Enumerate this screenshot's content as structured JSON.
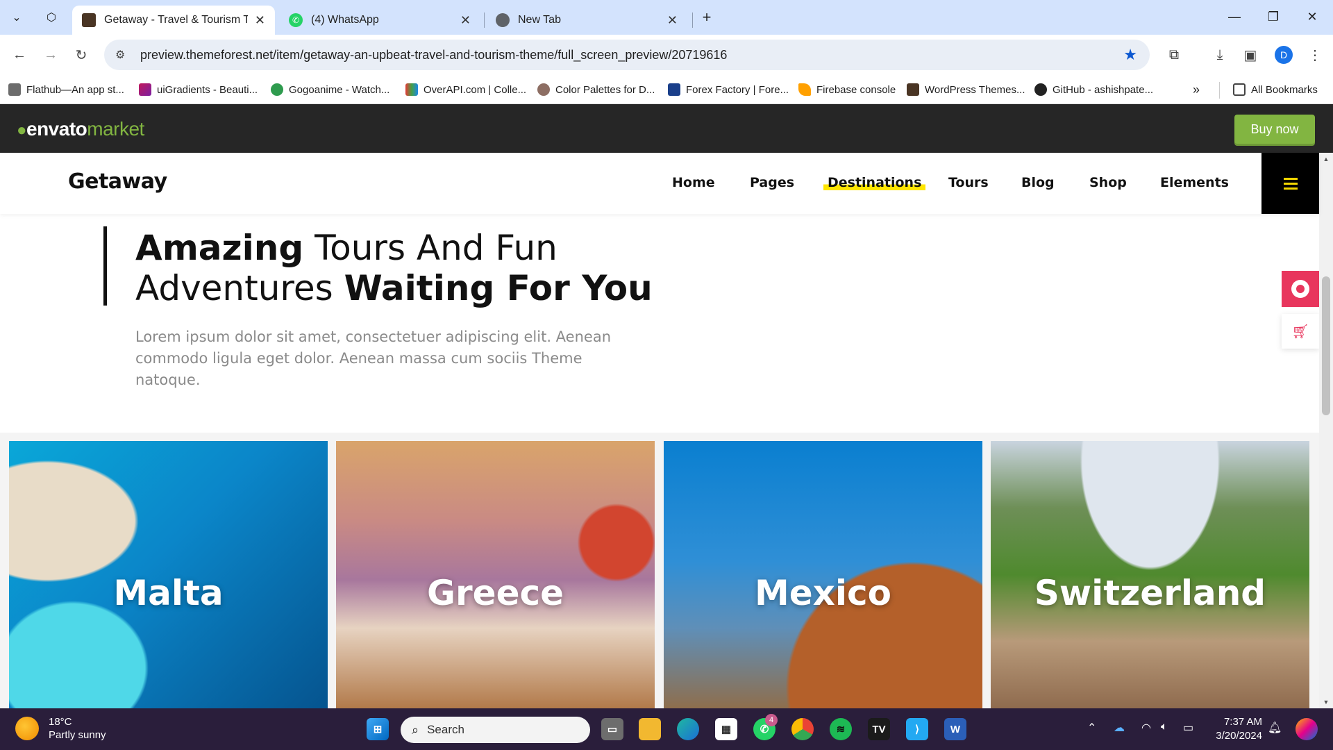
{
  "browser": {
    "tabs": [
      {
        "title": "Getaway - Travel & Tourism The",
        "active": true
      },
      {
        "title": "(4) WhatsApp",
        "active": false
      },
      {
        "title": "New Tab",
        "active": false
      }
    ],
    "url": "preview.themeforest.net/item/getaway-an-upbeat-travel-and-tourism-theme/full_screen_preview/20719616",
    "profile_initial": "D",
    "bookmarks": [
      "Flathub—An app st...",
      "uiGradients - Beauti...",
      "Gogoanime - Watch...",
      "OverAPI.com | Colle...",
      "Color Palettes for D...",
      "Forex Factory | Fore...",
      "Firebase console",
      "WordPress Themes...",
      "GitHub - ashishpate..."
    ],
    "all_bookmarks": "All Bookmarks"
  },
  "envato": {
    "logo_main": "envato",
    "logo_sub": "market",
    "buy_label": "Buy now",
    "brand_color": "#82b541"
  },
  "site": {
    "brand": "Getaway",
    "menu": [
      "Home",
      "Pages",
      "Destinations",
      "Tours",
      "Blog",
      "Shop",
      "Elements"
    ],
    "active_menu": "Destinations",
    "highlight_color": "#ffe600",
    "hero": {
      "title_bold_1": "Amazing",
      "title_regular_1": " Tours And Fun",
      "title_regular_2": "Adventures ",
      "title_bold_2": "Waiting For You",
      "description": "Lorem ipsum dolor sit amet, consectetuer adipiscing elit. Aenean commodo ligula eget dolor. Aenean massa cum sociis Theme natoque."
    },
    "destinations": [
      "Malta",
      "Greece",
      "Mexico",
      "Switzerland"
    ],
    "accent_color": "#e8365d"
  },
  "taskbar": {
    "weather_temp": "18°C",
    "weather_desc": "Partly sunny",
    "search_label": "Search",
    "whatsapp_badge": "4",
    "time": "7:37 AM",
    "date": "3/20/2024"
  }
}
